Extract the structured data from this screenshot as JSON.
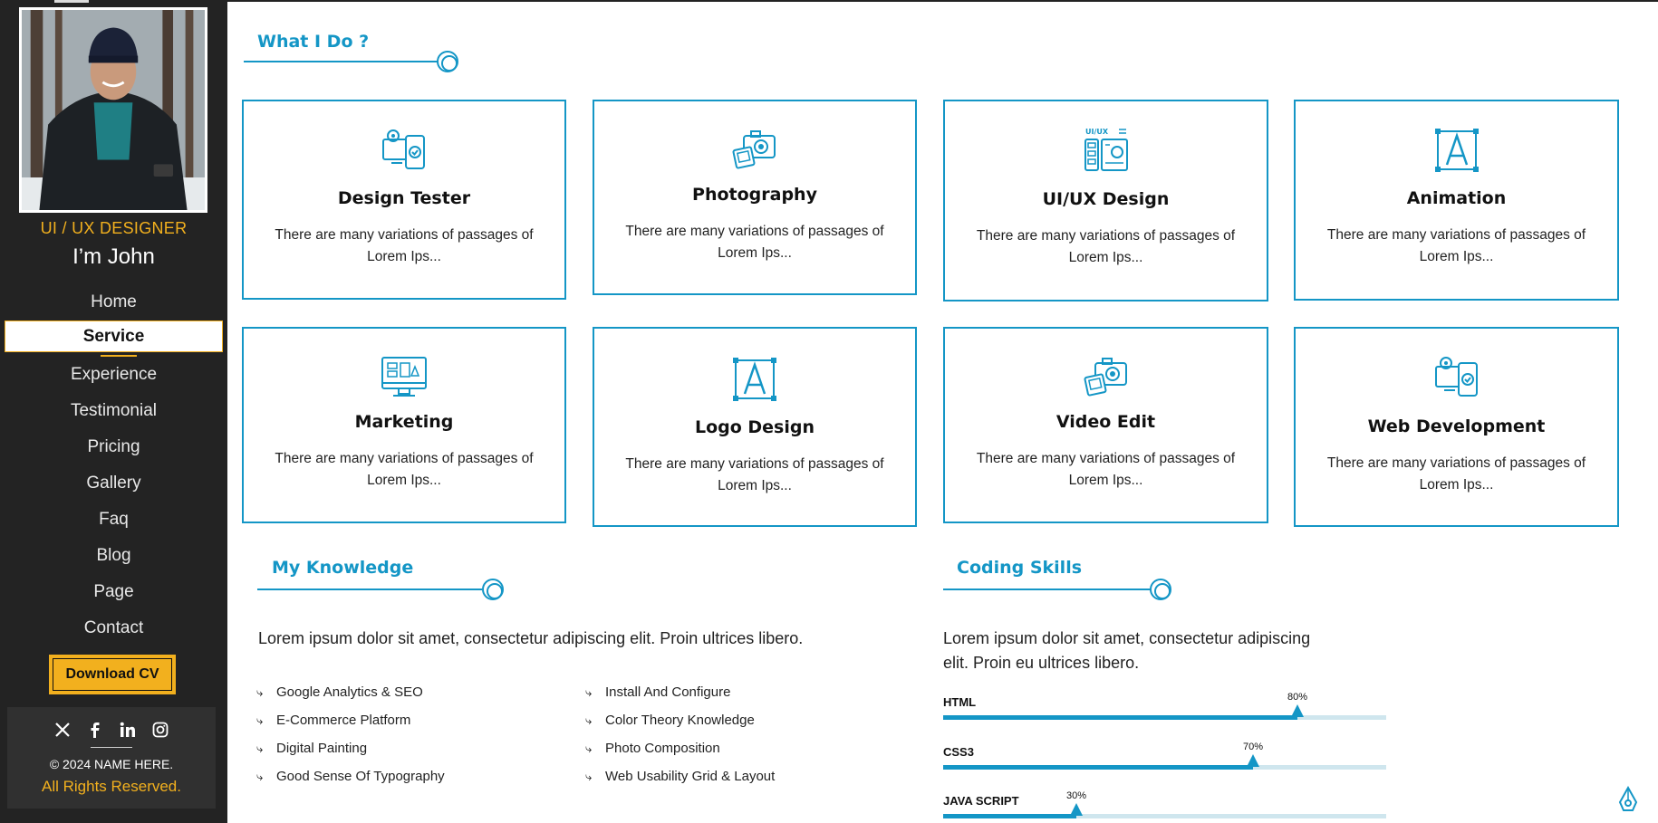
{
  "sidebar": {
    "role": "UI / UX DESIGNER",
    "name": "I’m John",
    "nav": [
      "Home",
      "Service",
      "Experience",
      "Testimonial",
      "Pricing",
      "Gallery",
      "Faq",
      "Blog",
      "Page",
      "Contact"
    ],
    "active_nav": "Service",
    "download_label": "Download CV",
    "social_icons": [
      "x-icon",
      "facebook-icon",
      "linkedin-icon",
      "instagram-icon"
    ],
    "copyright": "© 2024 NAME HERE.",
    "rights": "All Rights Reserved."
  },
  "what_i_do": {
    "title": "What I Do ?",
    "cards": [
      {
        "icon": "devices-icon",
        "title": "Design Tester",
        "text": "There are many variations of passages of Lorem Ips..."
      },
      {
        "icon": "camera-icon",
        "title": "Photography",
        "text": "There are many variations of passages of Lorem Ips..."
      },
      {
        "icon": "ui-layout-icon",
        "title": "UI/UX Design",
        "text": "There are many variations of passages of Lorem Ips..."
      },
      {
        "icon": "letter-a-icon",
        "title": "Animation",
        "text": "There are many variations of passages of Lorem Ips..."
      },
      {
        "icon": "monitor-icon",
        "title": "Marketing",
        "text": "There are many variations of passages of Lorem Ips..."
      },
      {
        "icon": "letter-a-icon",
        "title": "Logo Design",
        "text": "There are many variations of passages of Lorem Ips..."
      },
      {
        "icon": "camera-icon",
        "title": "Video Edit",
        "text": "There are many variations of passages of Lorem Ips..."
      },
      {
        "icon": "devices-icon",
        "title": "Web Development",
        "text": "There are many variations of passages of Lorem Ips..."
      }
    ]
  },
  "knowledge": {
    "title": "My Knowledge",
    "text": "Lorem ipsum dolor sit amet, consectetur adipiscing elit. Proin ultrices libero.",
    "col1": [
      "Google Analytics & SEO",
      "E-Commerce Platform",
      "Digital Painting",
      "Good Sense Of Typography"
    ],
    "col2": [
      "Install And Configure",
      "Color Theory Knowledge",
      "Photo Composition",
      "Web Usability Grid & Layout"
    ]
  },
  "coding": {
    "title": "Coding Skills",
    "text_line1": "Lorem ipsum dolor sit amet, consectetur adipiscing",
    "text_line2": "elit. Proin eu ultrices libero.",
    "skills": [
      {
        "name": "HTML",
        "percent": 80,
        "label": "80%"
      },
      {
        "name": "CSS3",
        "percent": 70,
        "label": "70%"
      },
      {
        "name": "JAVA SCRIPT",
        "percent": 30,
        "label": "30%"
      }
    ]
  },
  "colors": {
    "accent": "#1496c6",
    "highlight": "#f2b01e",
    "sidebar": "#232323"
  }
}
